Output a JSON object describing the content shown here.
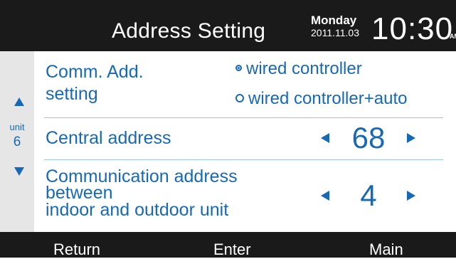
{
  "header": {
    "title": "Address Setting",
    "day": "Monday",
    "date": "2011.11.03",
    "time": "10:30",
    "ampm": "AM"
  },
  "sidebar": {
    "unit_label": "unit",
    "unit_value": "6"
  },
  "rows": {
    "comm": {
      "label_line1": "Comm. Add.",
      "label_line2": "setting",
      "options": [
        "wired controller",
        "wired controller+auto"
      ],
      "selected": "wired controller"
    },
    "central": {
      "label": "Central address",
      "value": "68"
    },
    "communication": {
      "label_line1": "Communication address",
      "label_line2": "between",
      "label_line3": "indoor and outdoor unit",
      "value": "4"
    }
  },
  "footer": {
    "return_label": "Return",
    "enter_label": "Enter",
    "main_label": "Main"
  },
  "colors": {
    "accent": "#1769b6",
    "bar": "#1a1a1a",
    "sidebar": "#e6e6e6",
    "separator": "#9bc4e6"
  }
}
